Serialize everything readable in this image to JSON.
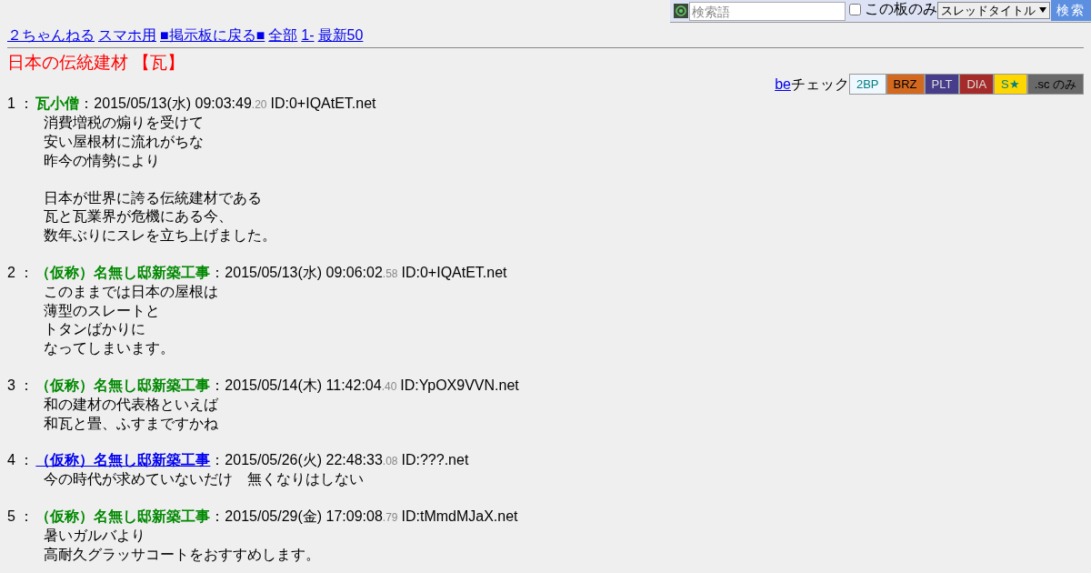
{
  "search_bar": {
    "placeholder": "検索語",
    "board_only": {
      "label": "この板のみ",
      "checked": false
    },
    "scope": "スレッドタイトル",
    "button": "検索"
  },
  "nav_links": [
    "２ちゃんねる",
    "スマホ用",
    "■掲示板に戻る■",
    "全部",
    "1-",
    "最新50"
  ],
  "thread_title": "日本の伝統建材 【瓦】",
  "be_check": {
    "link": "be",
    "label": "チェック"
  },
  "filters": [
    {
      "label": "2BP",
      "color": "#f0f8ff"
    },
    {
      "label": "BRZ",
      "color": "#d2691e"
    },
    {
      "label": "PLT",
      "color": "#483d8b"
    },
    {
      "label": "DIA",
      "color": "#a52a2a"
    },
    {
      "label": "S★",
      "color": "#ffd700"
    },
    {
      "label": ".sc のみ",
      "color": "#696969"
    }
  ],
  "posts": [
    {
      "number": "1 ：",
      "name": "瓦小僧",
      "kind": "plain",
      "date": "：2015/05/13(水) 09:03:49",
      "fraction": ".20",
      "id": "ID:0+IQAtET.net",
      "paragraphs": [
        [
          "消費増税の煽りを受けて",
          "安い屋根材に流れがちな",
          "昨今の情勢により"
        ],
        [
          "日本が世界に誇る伝統建材である",
          "瓦と瓦業界が危機にある今、",
          "数年ぶりにスレを立ち上げました。"
        ]
      ]
    },
    {
      "number": "2 ：",
      "name": "（仮称）名無し邸新築工事",
      "kind": "plain",
      "date": "：2015/05/13(水) 09:06:02",
      "fraction": ".58",
      "id": "ID:0+IQAtET.net",
      "paragraphs": [
        [
          "このままでは日本の屋根は",
          "薄型のスレートと",
          "トタンばかりに",
          "なってしまいます。"
        ]
      ]
    },
    {
      "number": "3 ：",
      "name": "（仮称）名無し邸新築工事",
      "kind": "plain",
      "date": "：2015/05/14(木) 11:42:04",
      "fraction": ".40",
      "id": "ID:YpOX9VVN.net",
      "paragraphs": [
        [
          "和の建材の代表格といえば",
          "和瓦と畳、ふすまですかね"
        ]
      ]
    },
    {
      "number": "4 ：",
      "name": "（仮称）名無し邸新築工事",
      "kind": "link",
      "date": "：2015/05/26(火) 22:48:33",
      "fraction": ".08",
      "id": "ID:???.net",
      "paragraphs": [
        [
          "今の時代が求めていないだけ　無くなりはしない"
        ]
      ]
    },
    {
      "number": "5 ：",
      "name": "（仮称）名無し邸新築工事",
      "kind": "plain",
      "date": "：2015/05/29(金) 17:09:08",
      "fraction": ".79",
      "id": "ID:tMmdMJaX.net",
      "paragraphs": [
        [
          "暑いガルバより",
          "高耐久グラッサコートをおすすめします。"
        ]
      ]
    }
  ]
}
